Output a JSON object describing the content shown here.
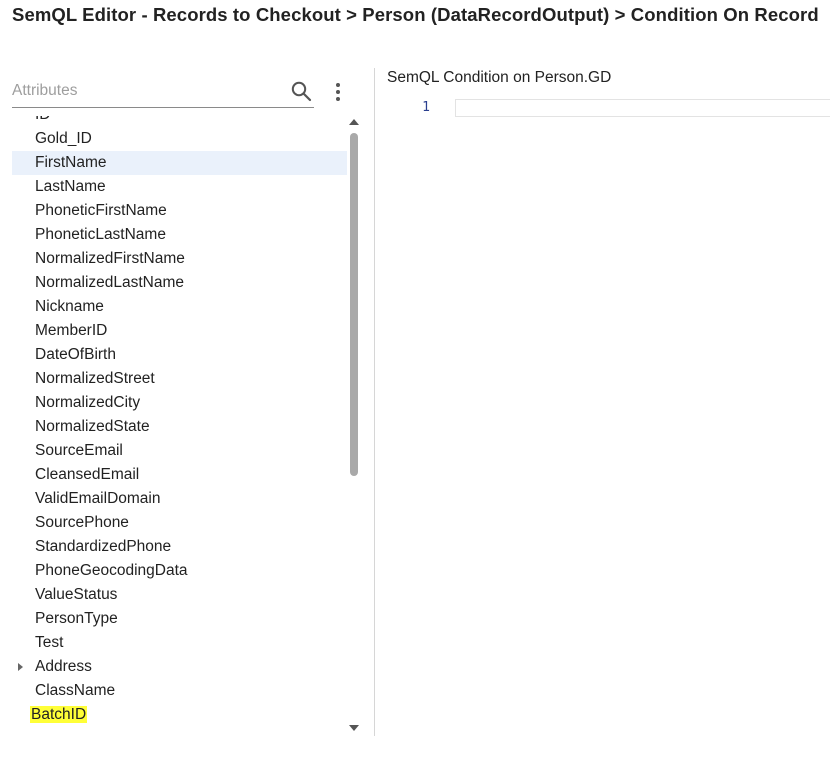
{
  "window": {
    "title": "SemQL Editor - Records to Checkout > Person (DataRecordOutput) > Condition On Record"
  },
  "attributes_panel": {
    "search": {
      "placeholder": "Attributes",
      "value": ""
    },
    "search_icon": "search-icon",
    "menu_icon": "more-vertical-icon",
    "items": [
      {
        "label": "ID"
      },
      {
        "label": "Gold_ID"
      },
      {
        "label": "FirstName",
        "selected": true
      },
      {
        "label": "LastName"
      },
      {
        "label": "PhoneticFirstName"
      },
      {
        "label": "PhoneticLastName"
      },
      {
        "label": "NormalizedFirstName"
      },
      {
        "label": "NormalizedLastName"
      },
      {
        "label": "Nickname"
      },
      {
        "label": "MemberID"
      },
      {
        "label": "DateOfBirth"
      },
      {
        "label": "NormalizedStreet"
      },
      {
        "label": "NormalizedCity"
      },
      {
        "label": "NormalizedState"
      },
      {
        "label": "SourceEmail"
      },
      {
        "label": "CleansedEmail"
      },
      {
        "label": "ValidEmailDomain"
      },
      {
        "label": "SourcePhone"
      },
      {
        "label": "StandardizedPhone"
      },
      {
        "label": "PhoneGeocodingData"
      },
      {
        "label": "ValueStatus"
      },
      {
        "label": "PersonType"
      },
      {
        "label": "Test"
      },
      {
        "label": "Address",
        "expandable": true
      },
      {
        "label": "ClassName"
      },
      {
        "label": "BatchID",
        "highlighted": true
      }
    ],
    "colors": {
      "selected_row": "#eaf1fb",
      "highlight": "#ffff38"
    }
  },
  "editor": {
    "title": "SemQL Condition on Person.GD",
    "lines": [
      {
        "number": "1",
        "text": ""
      }
    ]
  }
}
